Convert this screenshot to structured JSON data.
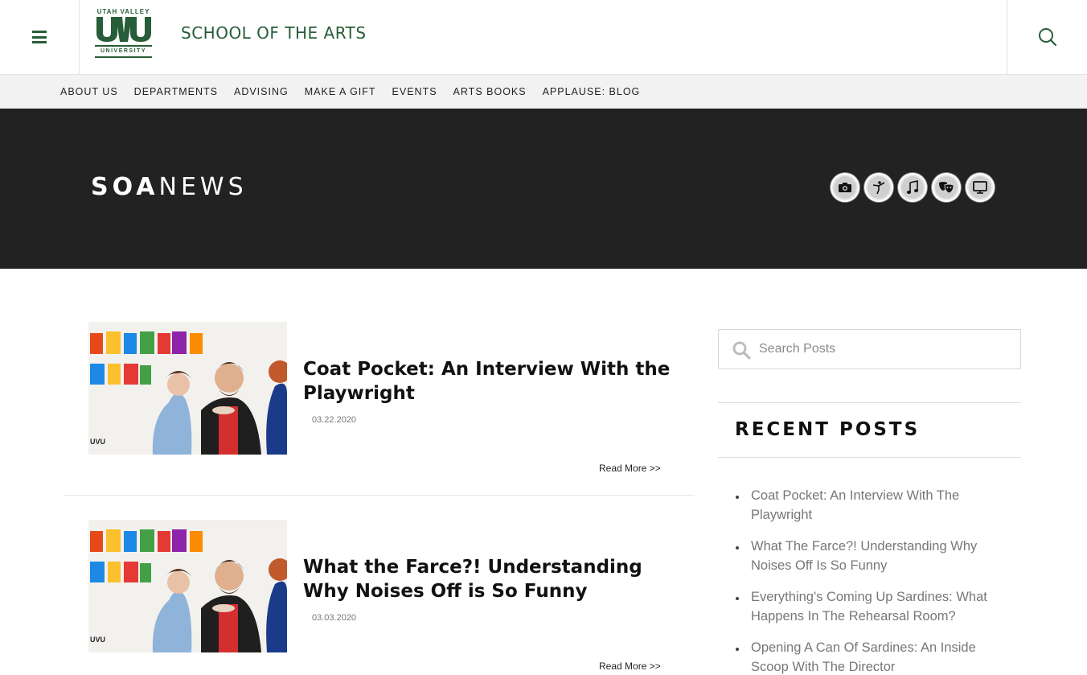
{
  "header": {
    "logo": {
      "top_text": "UTAH VALLEY",
      "mark": "UVU",
      "bottom_text": "UNIVERSITY"
    },
    "site_title": "SCHOOL OF THE ARTS",
    "menu_icon": "hamburger-menu-icon",
    "search_icon": "search-icon",
    "brand_color": "#275d38"
  },
  "nav": {
    "items": [
      {
        "label": "ABOUT US"
      },
      {
        "label": "DEPARTMENTS"
      },
      {
        "label": "ADVISING"
      },
      {
        "label": "MAKE A GIFT"
      },
      {
        "label": "EVENTS"
      },
      {
        "label": "ARTS BOOKS"
      },
      {
        "label": "APPLAUSE: BLOG"
      }
    ]
  },
  "banner": {
    "title_bold": "SOA",
    "title_light": "NEWS",
    "background": "#222222",
    "department_icons": [
      {
        "icon": "camera-icon"
      },
      {
        "icon": "dance-icon"
      },
      {
        "icon": "music-note-icon"
      },
      {
        "icon": "theatre-masks-icon"
      },
      {
        "icon": "monitor-icon"
      }
    ]
  },
  "posts": [
    {
      "title": "Coat Pocket: An Interview With the Playwright",
      "date": "03.22.2020",
      "read_more": "Read More >>",
      "image": "noises-off-poster"
    },
    {
      "title": "What the Farce?! Understanding Why Noises Off is So Funny",
      "date": "03.03.2020",
      "read_more": "Read More >>",
      "image": "noises-off-poster"
    }
  ],
  "sidebar": {
    "search": {
      "placeholder": "Search Posts",
      "value": ""
    },
    "recent_heading": "RECENT POSTS",
    "recent_posts": [
      {
        "label": "Coat Pocket: An Interview With The Playwright"
      },
      {
        "label": "What The Farce?! Understanding Why Noises Off Is So Funny"
      },
      {
        "label": "Everything's Coming Up Sardines: What Happens In The Rehearsal Room?"
      },
      {
        "label": "Opening A Can Of Sardines: An Inside Scoop With The Director"
      }
    ]
  }
}
